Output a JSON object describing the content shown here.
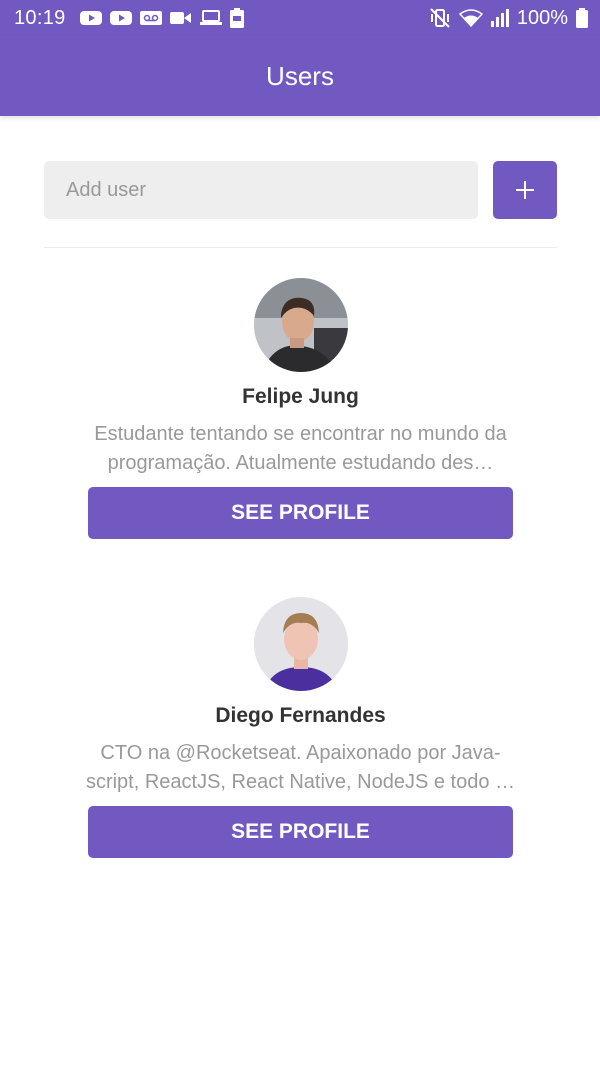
{
  "status_bar": {
    "time": "10:19",
    "battery": "100%",
    "icons_left": [
      "youtube-icon",
      "youtube-icon",
      "voicemail-icon",
      "video-camera-icon",
      "laptop-icon",
      "battery-100-icon"
    ],
    "icons_right": [
      "mute-vibrate-icon",
      "wifi-icon",
      "signal-icon",
      "battery-icon"
    ]
  },
  "header": {
    "title": "Users"
  },
  "form": {
    "placeholder": "Add user",
    "add_icon": "plus-icon"
  },
  "users": [
    {
      "name": "Felipe Jung",
      "bio": "Estudante tentando se encontrar no mundo da programação. Atualmente estudando des…",
      "button": "See Profile"
    },
    {
      "name": "Diego Fernandes",
      "bio": "CTO na @Rocketseat. Apaixonado por Java-script, ReactJS, React Native, NodeJS e todo …",
      "button": "See Profile"
    }
  ],
  "colors": {
    "primary": "#7159c1",
    "input_bg": "#eeeeee",
    "text": "#333333",
    "muted": "#999999"
  }
}
